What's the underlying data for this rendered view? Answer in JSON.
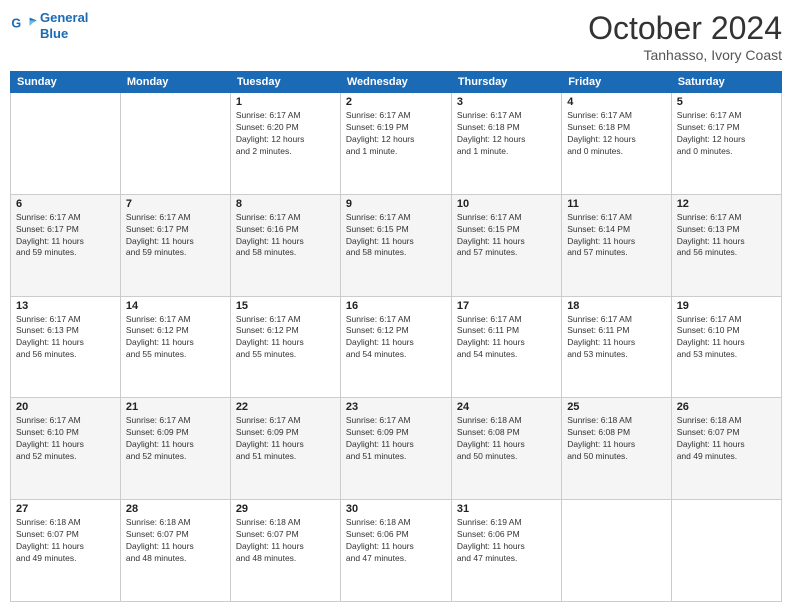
{
  "header": {
    "logo_line1": "General",
    "logo_line2": "Blue",
    "month": "October 2024",
    "location": "Tanhasso, Ivory Coast"
  },
  "weekdays": [
    "Sunday",
    "Monday",
    "Tuesday",
    "Wednesday",
    "Thursday",
    "Friday",
    "Saturday"
  ],
  "weeks": [
    [
      {
        "day": "",
        "info": ""
      },
      {
        "day": "",
        "info": ""
      },
      {
        "day": "1",
        "info": "Sunrise: 6:17 AM\nSunset: 6:20 PM\nDaylight: 12 hours\nand 2 minutes."
      },
      {
        "day": "2",
        "info": "Sunrise: 6:17 AM\nSunset: 6:19 PM\nDaylight: 12 hours\nand 1 minute."
      },
      {
        "day": "3",
        "info": "Sunrise: 6:17 AM\nSunset: 6:18 PM\nDaylight: 12 hours\nand 1 minute."
      },
      {
        "day": "4",
        "info": "Sunrise: 6:17 AM\nSunset: 6:18 PM\nDaylight: 12 hours\nand 0 minutes."
      },
      {
        "day": "5",
        "info": "Sunrise: 6:17 AM\nSunset: 6:17 PM\nDaylight: 12 hours\nand 0 minutes."
      }
    ],
    [
      {
        "day": "6",
        "info": "Sunrise: 6:17 AM\nSunset: 6:17 PM\nDaylight: 11 hours\nand 59 minutes."
      },
      {
        "day": "7",
        "info": "Sunrise: 6:17 AM\nSunset: 6:17 PM\nDaylight: 11 hours\nand 59 minutes."
      },
      {
        "day": "8",
        "info": "Sunrise: 6:17 AM\nSunset: 6:16 PM\nDaylight: 11 hours\nand 58 minutes."
      },
      {
        "day": "9",
        "info": "Sunrise: 6:17 AM\nSunset: 6:15 PM\nDaylight: 11 hours\nand 58 minutes."
      },
      {
        "day": "10",
        "info": "Sunrise: 6:17 AM\nSunset: 6:15 PM\nDaylight: 11 hours\nand 57 minutes."
      },
      {
        "day": "11",
        "info": "Sunrise: 6:17 AM\nSunset: 6:14 PM\nDaylight: 11 hours\nand 57 minutes."
      },
      {
        "day": "12",
        "info": "Sunrise: 6:17 AM\nSunset: 6:13 PM\nDaylight: 11 hours\nand 56 minutes."
      }
    ],
    [
      {
        "day": "13",
        "info": "Sunrise: 6:17 AM\nSunset: 6:13 PM\nDaylight: 11 hours\nand 56 minutes."
      },
      {
        "day": "14",
        "info": "Sunrise: 6:17 AM\nSunset: 6:12 PM\nDaylight: 11 hours\nand 55 minutes."
      },
      {
        "day": "15",
        "info": "Sunrise: 6:17 AM\nSunset: 6:12 PM\nDaylight: 11 hours\nand 55 minutes."
      },
      {
        "day": "16",
        "info": "Sunrise: 6:17 AM\nSunset: 6:12 PM\nDaylight: 11 hours\nand 54 minutes."
      },
      {
        "day": "17",
        "info": "Sunrise: 6:17 AM\nSunset: 6:11 PM\nDaylight: 11 hours\nand 54 minutes."
      },
      {
        "day": "18",
        "info": "Sunrise: 6:17 AM\nSunset: 6:11 PM\nDaylight: 11 hours\nand 53 minutes."
      },
      {
        "day": "19",
        "info": "Sunrise: 6:17 AM\nSunset: 6:10 PM\nDaylight: 11 hours\nand 53 minutes."
      }
    ],
    [
      {
        "day": "20",
        "info": "Sunrise: 6:17 AM\nSunset: 6:10 PM\nDaylight: 11 hours\nand 52 minutes."
      },
      {
        "day": "21",
        "info": "Sunrise: 6:17 AM\nSunset: 6:09 PM\nDaylight: 11 hours\nand 52 minutes."
      },
      {
        "day": "22",
        "info": "Sunrise: 6:17 AM\nSunset: 6:09 PM\nDaylight: 11 hours\nand 51 minutes."
      },
      {
        "day": "23",
        "info": "Sunrise: 6:17 AM\nSunset: 6:09 PM\nDaylight: 11 hours\nand 51 minutes."
      },
      {
        "day": "24",
        "info": "Sunrise: 6:18 AM\nSunset: 6:08 PM\nDaylight: 11 hours\nand 50 minutes."
      },
      {
        "day": "25",
        "info": "Sunrise: 6:18 AM\nSunset: 6:08 PM\nDaylight: 11 hours\nand 50 minutes."
      },
      {
        "day": "26",
        "info": "Sunrise: 6:18 AM\nSunset: 6:07 PM\nDaylight: 11 hours\nand 49 minutes."
      }
    ],
    [
      {
        "day": "27",
        "info": "Sunrise: 6:18 AM\nSunset: 6:07 PM\nDaylight: 11 hours\nand 49 minutes."
      },
      {
        "day": "28",
        "info": "Sunrise: 6:18 AM\nSunset: 6:07 PM\nDaylight: 11 hours\nand 48 minutes."
      },
      {
        "day": "29",
        "info": "Sunrise: 6:18 AM\nSunset: 6:07 PM\nDaylight: 11 hours\nand 48 minutes."
      },
      {
        "day": "30",
        "info": "Sunrise: 6:18 AM\nSunset: 6:06 PM\nDaylight: 11 hours\nand 47 minutes."
      },
      {
        "day": "31",
        "info": "Sunrise: 6:19 AM\nSunset: 6:06 PM\nDaylight: 11 hours\nand 47 minutes."
      },
      {
        "day": "",
        "info": ""
      },
      {
        "day": "",
        "info": ""
      }
    ]
  ]
}
